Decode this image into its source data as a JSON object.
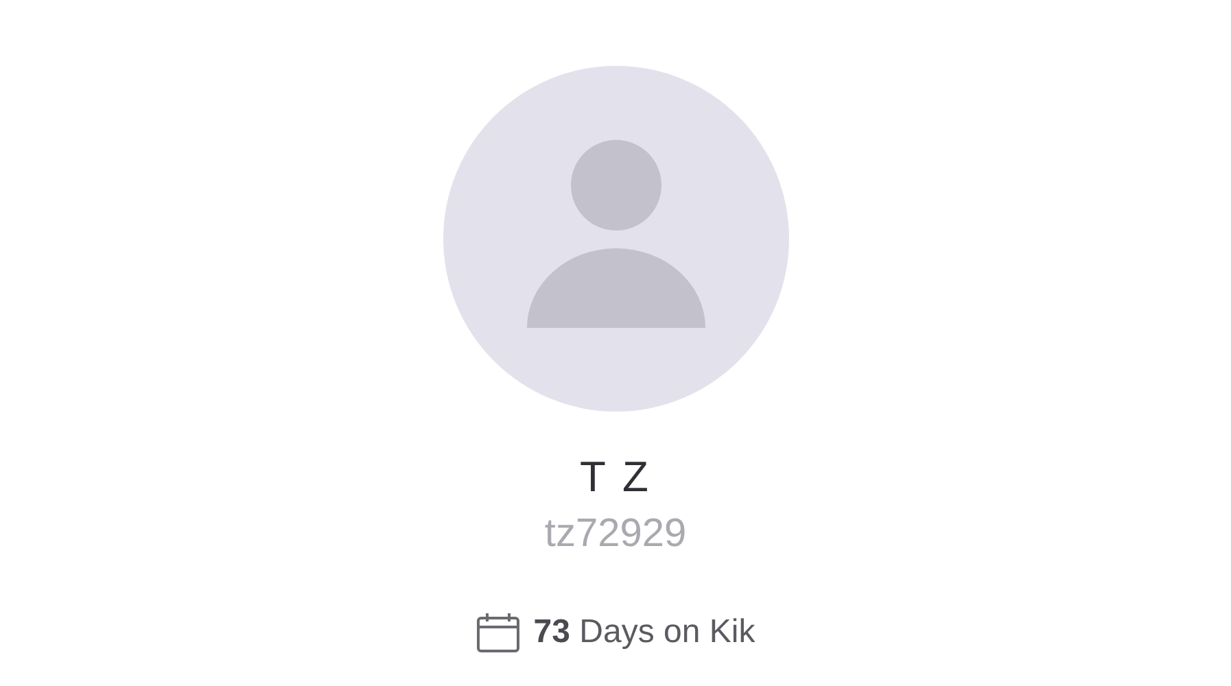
{
  "profile": {
    "display_name": "T Z",
    "username": "tz72929",
    "days_on_kik": "**73** Days on Kik"
  }
}
